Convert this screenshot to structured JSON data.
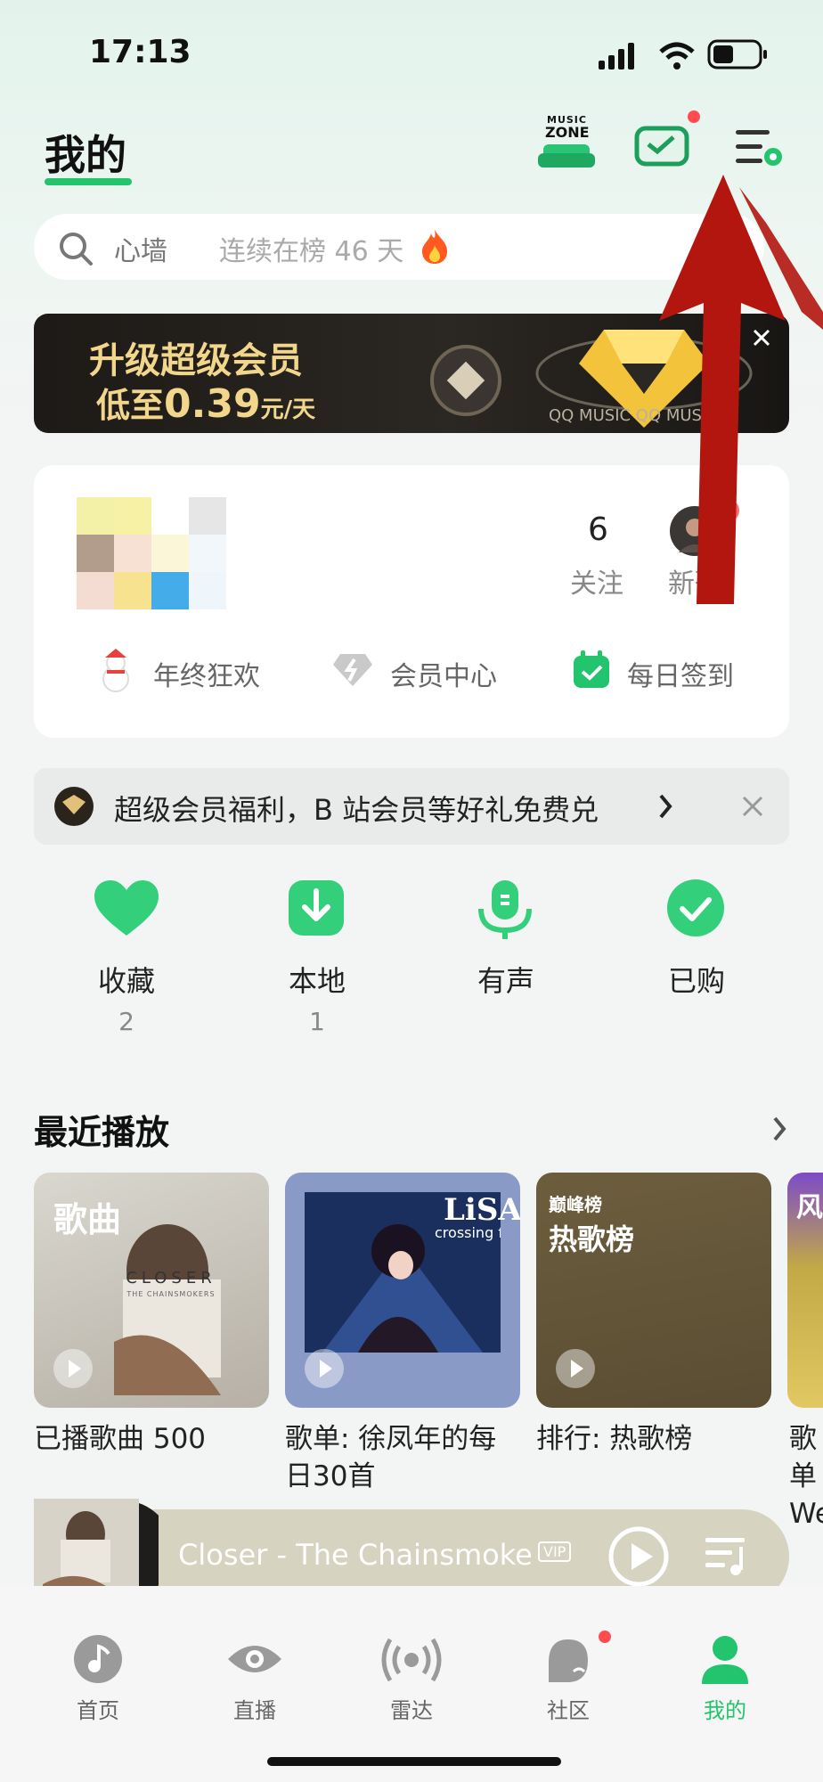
{
  "status_bar": {
    "time": "17:13"
  },
  "header": {
    "title": "我的",
    "music_zone_line1": "MUSIC",
    "music_zone_line2": "ZONE"
  },
  "search": {
    "keyword": "心墙",
    "rank_text": "连续在榜 46 天"
  },
  "banner": {
    "line1": "升级超级会员",
    "line2_prefix": "低至",
    "line2_price": "0.39",
    "line2_suffix": "元/天",
    "brand_text": "QQ MUSIC QQ MUSIC"
  },
  "profile": {
    "following_count": "6",
    "following_label": "关注",
    "new_label": "新歌",
    "quick": [
      {
        "label": "年终狂欢"
      },
      {
        "label": "会员中心"
      },
      {
        "label": "每日签到"
      }
    ]
  },
  "promo": {
    "text": "超级会员福利，B 站会员等好礼免费兑"
  },
  "grid": [
    {
      "label": "收藏",
      "count": "2"
    },
    {
      "label": "本地",
      "count": "1"
    },
    {
      "label": "有声",
      "count": ""
    },
    {
      "label": "已购",
      "count": ""
    }
  ],
  "recent": {
    "title": "最近播放",
    "items": [
      {
        "cover_tag": "歌曲",
        "cover_text": "CLOSER",
        "cover_sub": "THE CHAINSMOKERS",
        "caption": "已播歌曲 500"
      },
      {
        "cover_text": "LiSA",
        "cover_sub": "crossing fie",
        "caption": "歌单: 徐凤年的每日30首"
      },
      {
        "cover_tag": "巅峰榜",
        "cover_text": "热歌榜",
        "caption": "排行: 热歌榜"
      },
      {
        "cover_tag": "风",
        "caption": "歌单",
        "caption2": "We"
      }
    ]
  },
  "player": {
    "title": "Closer - The Chainsmokers",
    "vip_badge": "VIP"
  },
  "tabbar": [
    {
      "label": "首页"
    },
    {
      "label": "直播"
    },
    {
      "label": "雷达"
    },
    {
      "label": "社区"
    },
    {
      "label": "我的"
    }
  ],
  "colors": {
    "accent": "#22c46e",
    "arrow": "#b3160f",
    "banner_gold": "#f1d68c"
  }
}
